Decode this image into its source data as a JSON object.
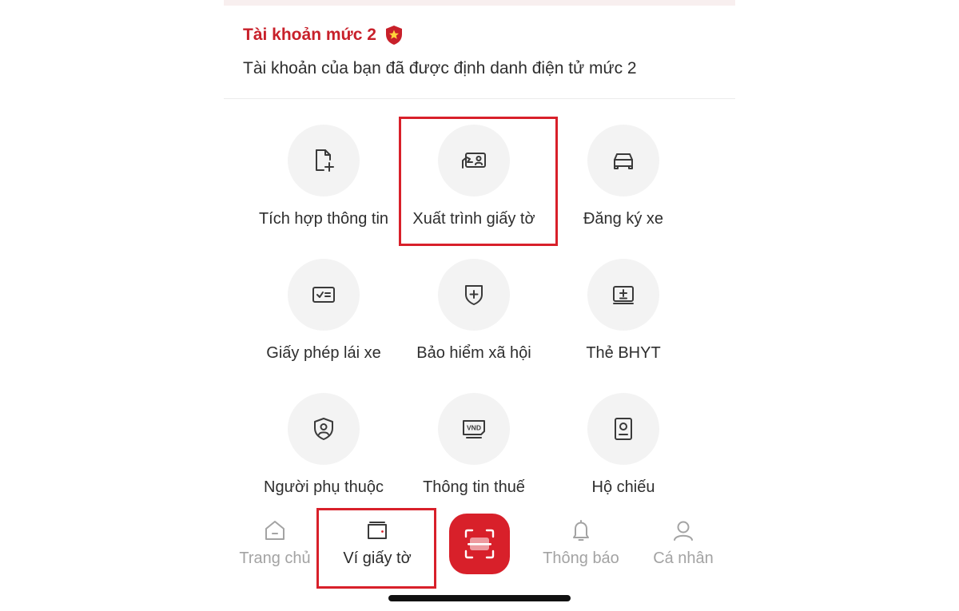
{
  "account": {
    "title": "Tài khoản mức 2",
    "subtitle": "Tài khoản của bạn đã được định danh điện tử mức 2",
    "badge_icon": "shield-star-icon"
  },
  "services": [
    {
      "label": "Tích hợp thông tin",
      "icon": "file-plus-icon"
    },
    {
      "label": "Xuất trình giấy tờ",
      "icon": "id-card-hand-icon"
    },
    {
      "label": "Đăng ký xe",
      "icon": "car-icon"
    },
    {
      "label": "Giấy phép lái xe",
      "icon": "license-card-icon"
    },
    {
      "label": "Bảo hiểm xã hội",
      "icon": "shield-plus-icon"
    },
    {
      "label": "Thẻ BHYT",
      "icon": "health-card-icon"
    },
    {
      "label": "Người phụ thuộc",
      "icon": "shield-person-icon"
    },
    {
      "label": "Thông tin thuế",
      "icon": "vnd-note-icon"
    },
    {
      "label": "Hộ chiếu",
      "icon": "passport-icon"
    }
  ],
  "nav": {
    "items": [
      {
        "label": "Trang chủ",
        "icon": "home-icon"
      },
      {
        "label": "Ví giấy tờ",
        "icon": "wallet-icon"
      },
      {
        "label": "Thông báo",
        "icon": "bell-icon"
      },
      {
        "label": "Cá nhân",
        "icon": "person-icon"
      }
    ],
    "active": "Ví giấy tờ",
    "scan_icon": "scan-icon"
  },
  "colors": {
    "accent": "#d8202a",
    "icon_bg": "#f3f3f3",
    "inactive": "#a3a3a3"
  }
}
